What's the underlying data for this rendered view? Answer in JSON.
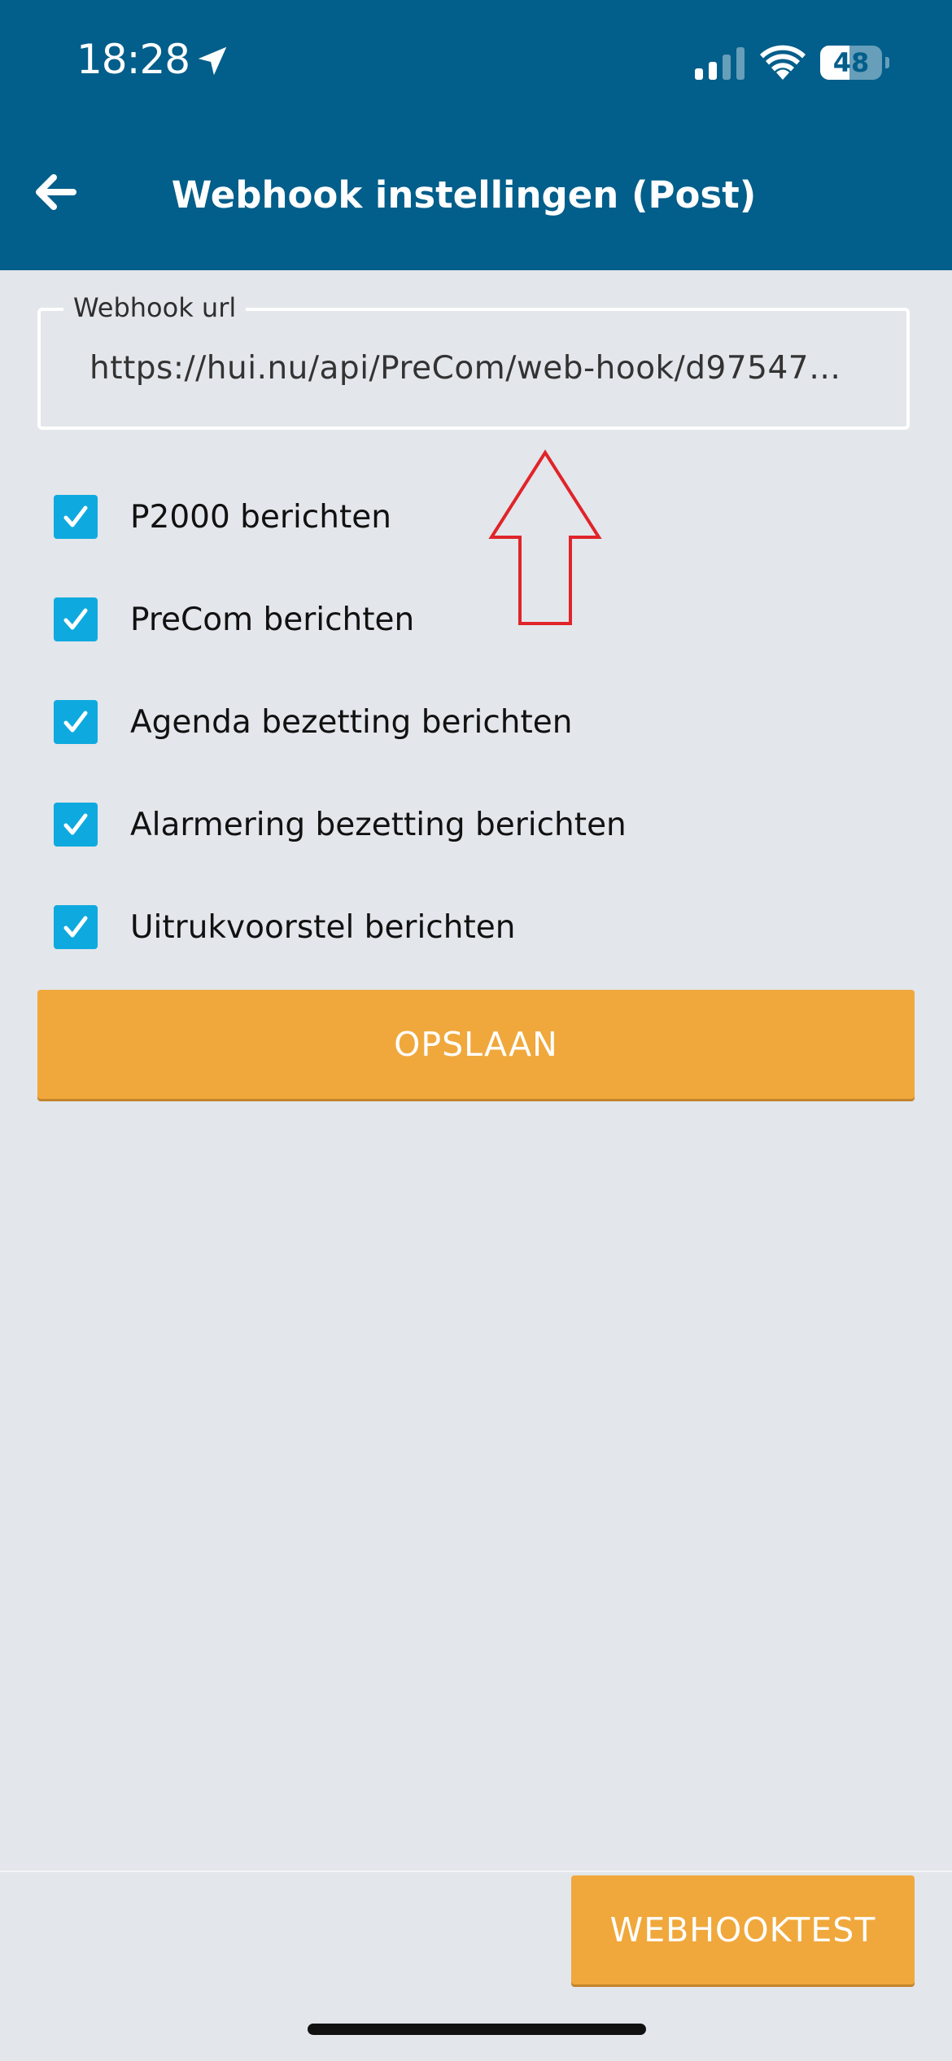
{
  "status_bar": {
    "time": "18:28",
    "battery_level": "48",
    "battery_fraction": 0.48,
    "icons": [
      "location-arrow-icon",
      "signal-icon",
      "wifi-icon",
      "battery-icon"
    ]
  },
  "header": {
    "back_icon": "arrow-left-icon",
    "title": "Webhook instellingen (Post)"
  },
  "form": {
    "url_label": "Webhook url",
    "url_value": "https://hui.nu/api/PreCom/web-hook/d97547…",
    "checkboxes": [
      {
        "label": "P2000 berichten",
        "checked": true
      },
      {
        "label": "PreCom berichten",
        "checked": true
      },
      {
        "label": "Agenda bezetting berichten",
        "checked": true
      },
      {
        "label": "Alarmering bezetting berichten",
        "checked": true
      },
      {
        "label": "Uitrukvoorstel berichten",
        "checked": true
      }
    ],
    "save_label": "OPSLAAN"
  },
  "footer": {
    "test_label": "WEBHOOKTEST"
  },
  "colors": {
    "header": "#025e8a",
    "background": "#e3e6eb",
    "accent_button": "#f0a83c",
    "checkbox": "#0eaadf",
    "annotation_arrow": "#e0242a"
  }
}
